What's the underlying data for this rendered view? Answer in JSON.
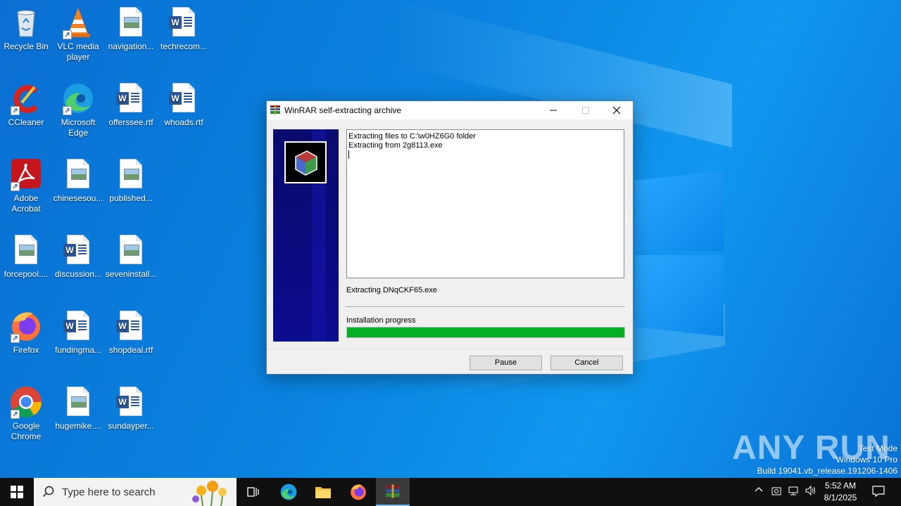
{
  "desktop": {
    "icons": [
      {
        "label": "Recycle Bin",
        "icon": "recycle-bin-icon"
      },
      {
        "label": "VLC media player",
        "icon": "vlc-icon"
      },
      {
        "label": "navigation...",
        "icon": "image-file-icon"
      },
      {
        "label": "techrecom...",
        "icon": "word-doc-icon"
      },
      {
        "label": "CCleaner",
        "icon": "ccleaner-icon"
      },
      {
        "label": "Microsoft Edge",
        "icon": "edge-icon"
      },
      {
        "label": "offerssee.rtf",
        "icon": "word-doc-icon"
      },
      {
        "label": "whoads.rtf",
        "icon": "word-doc-icon"
      },
      {
        "label": "Adobe Acrobat",
        "icon": "acrobat-icon"
      },
      {
        "label": "chinesesou...",
        "icon": "image-file-icon"
      },
      {
        "label": "published...",
        "icon": "image-file-icon"
      },
      {
        "label": "forcepool....",
        "icon": "image-file-icon"
      },
      {
        "label": "discussion...",
        "icon": "word-doc-icon"
      },
      {
        "label": "seveninstall...",
        "icon": "image-file-icon"
      },
      {
        "label": "Firefox",
        "icon": "firefox-icon"
      },
      {
        "label": "fundingma...",
        "icon": "word-doc-icon"
      },
      {
        "label": "shopdeal.rtf",
        "icon": "word-doc-icon"
      },
      {
        "label": "Google Chrome",
        "icon": "chrome-icon"
      },
      {
        "label": "hugemike....",
        "icon": "image-file-icon"
      },
      {
        "label": "sundayper...",
        "icon": "word-doc-icon"
      }
    ]
  },
  "window": {
    "title": "WinRAR self-extracting archive",
    "log_lines": [
      "Extracting files to C:\\w0HZ6G0 folder",
      "Extracting from 2g8113.exe"
    ],
    "current_file": "Extracting DNqCKF65.exe",
    "progress_label": "Installation progress",
    "progress": 1.0,
    "pause_label": "Pause",
    "cancel_label": "Cancel"
  },
  "taskbar": {
    "search_placeholder": "Type here to search",
    "time": "5:52 AM",
    "date": "8/1/2025"
  },
  "watermark": {
    "line1": "Test Mode",
    "line2": "Windows 10 Pro",
    "line3": "Build 19041.vb_release.191206-1406",
    "brand": "ANY RUN"
  },
  "colors": {
    "progress": "#06b025",
    "desktop": "#0a78d7",
    "taskbar": "#101010"
  }
}
